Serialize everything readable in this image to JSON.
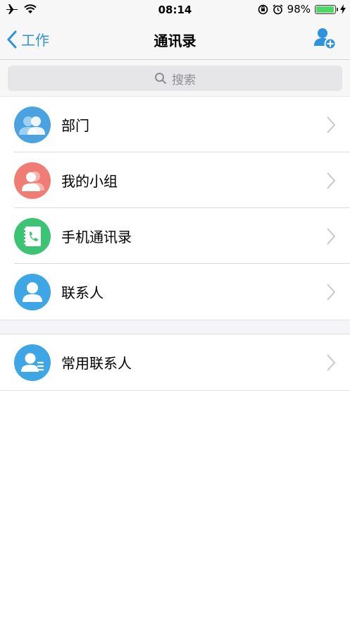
{
  "status": {
    "time": "08:14",
    "battery": "98%",
    "battery_level": 0.98
  },
  "nav": {
    "back_label": "工作",
    "title": "通讯录"
  },
  "search": {
    "placeholder": "搜索"
  },
  "items": [
    {
      "label": "部门",
      "color": "#4aa3e0"
    },
    {
      "label": "我的小组",
      "color": "#ef7d76"
    },
    {
      "label": "手机通讯录",
      "color": "#3cc374"
    },
    {
      "label": "联系人",
      "color": "#3ea6e4"
    }
  ],
  "frequent": {
    "label": "常用联系人",
    "color": "#3ea6e4"
  },
  "colors": {
    "accent": "#2d93de"
  }
}
